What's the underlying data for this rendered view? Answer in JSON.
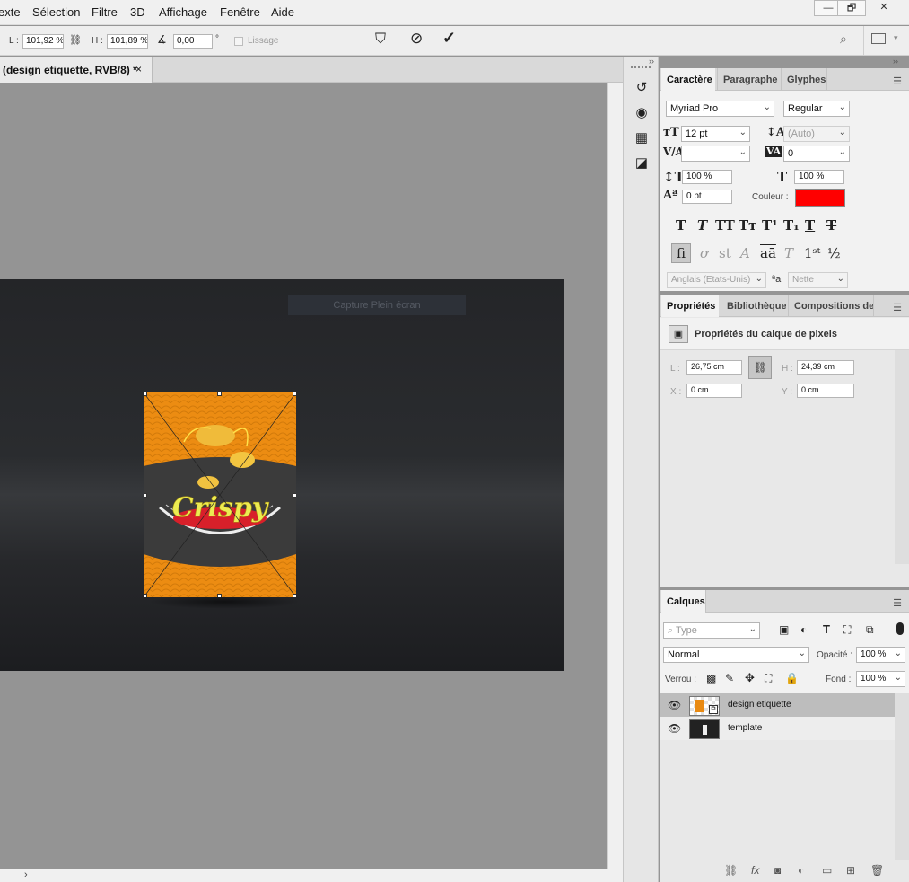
{
  "menubar": {
    "items": [
      "exte",
      "Sélection",
      "Filtre",
      "3D",
      "Affichage",
      "Fenêtre",
      "Aide"
    ],
    "window_buttons": [
      "—",
      "🗗",
      "✕"
    ]
  },
  "options": {
    "w_label": "L :",
    "w_value": "101,92 %",
    "h_label": "H :",
    "h_value": "101,89 %",
    "angle_value": "0,00",
    "angle_unit": "°",
    "lissage": "Lissage"
  },
  "document": {
    "tab_title": "(design etiquette, RVB/8) *",
    "tab_close": "×",
    "ghost_tooltip": "Capture Plein écran",
    "brand_text": "Crispy"
  },
  "character": {
    "tabs": [
      "Caractère",
      "Paragraphe",
      "Glyphes"
    ],
    "font_family": "Myriad Pro",
    "font_style": "Regular",
    "size": "12 pt",
    "leading": "(Auto)",
    "kerning": "",
    "tracking": "0",
    "vscale": "100 %",
    "hscale": "100 %",
    "baseline": "0 pt",
    "color_label": "Couleur :",
    "color_value": "#ff0000",
    "language": "Anglais (Etats-Unis)",
    "antialias": "Nette",
    "aa_label": "ªa"
  },
  "properties": {
    "tabs": [
      "Propriétés",
      "Bibliothèques",
      "Compositions de ca"
    ],
    "title": "Propriétés du calque de pixels",
    "l_label": "L :",
    "l_value": "26,75 cm",
    "h_label": "H :",
    "h_value": "24,39 cm",
    "x_label": "X :",
    "x_value": "0 cm",
    "y_label": "Y :",
    "y_value": "0 cm"
  },
  "layers": {
    "tab": "Calques",
    "search_placeholder": "Type",
    "blend_mode": "Normal",
    "opacity_label": "Opacité :",
    "opacity_value": "100 %",
    "lock_label": "Verrou :",
    "fill_label": "Fond :",
    "fill_value": "100 %",
    "items": [
      {
        "name": "design etiquette",
        "selected": true
      },
      {
        "name": "template",
        "selected": false
      }
    ]
  }
}
